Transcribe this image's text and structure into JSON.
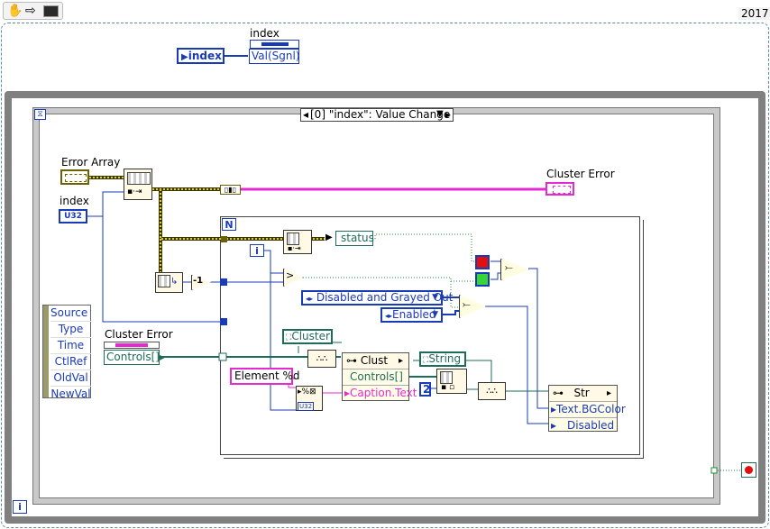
{
  "toolbar": {
    "version": "2017"
  },
  "index_block": {
    "label": "index",
    "const_label": "index",
    "fn_label": "Val(Sgnl)"
  },
  "event": {
    "selector": "[0] \"index\": Value Change"
  },
  "error_array": {
    "label": "Error Array"
  },
  "index_ctrl": {
    "label": "index",
    "type": "U32"
  },
  "cluster_error_out": {
    "label": "Cluster Error"
  },
  "cluster_error_ref": {
    "label": "Cluster Error",
    "prop": "Controls[]"
  },
  "event_data": [
    "Source",
    "Type",
    "Time",
    "CtlRef",
    "OldVal",
    "NewVal"
  ],
  "loop": {
    "count": "N",
    "iter": "i"
  },
  "status": "status",
  "decrement": "-1",
  "greater": ">",
  "disabled_enum": "Disabled and Grayed Out",
  "enabled_enum": "Enabled",
  "cluster_class": "Cluster",
  "string_class": "String",
  "format_string": "Element %d",
  "const_two": "2",
  "clust_node": {
    "class": "Clust",
    "props": [
      "Controls[]",
      "Caption.Text"
    ]
  },
  "str_node": {
    "class": "Str",
    "props": [
      "Text.BGColor",
      "Disabled"
    ]
  },
  "stop_iter": "i",
  "colors": {
    "red": "#e01010",
    "green": "#37d637",
    "error_wire": "#e62ad2",
    "numeric_wire": "#1a3bb8"
  }
}
